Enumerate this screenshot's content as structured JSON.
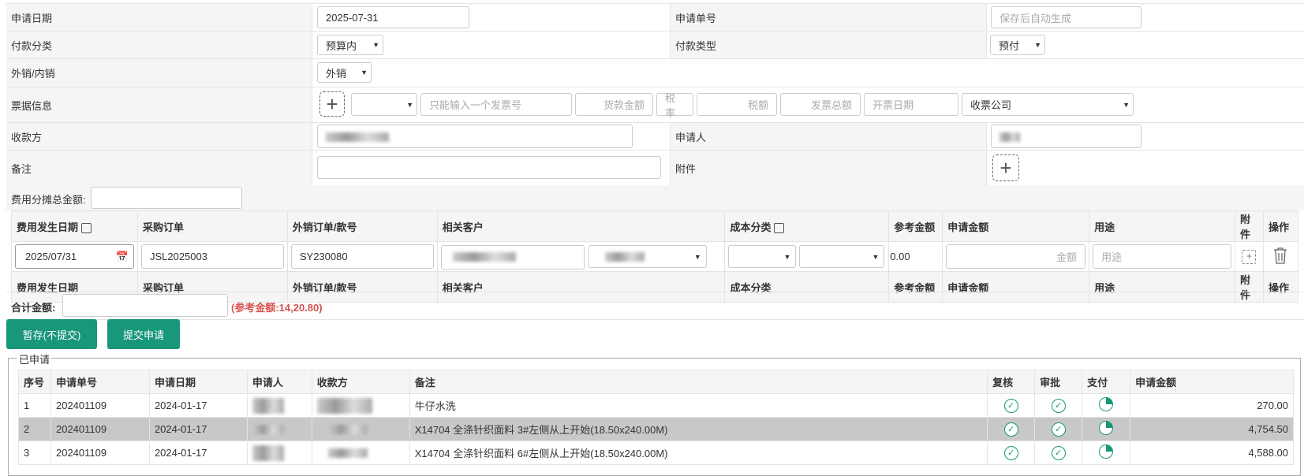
{
  "form": {
    "apply_date_label": "申请日期",
    "apply_date_value": "2025-07-31",
    "apply_no_label": "申请单号",
    "apply_no_placeholder": "保存后自动生成",
    "pay_category_label": "付款分类",
    "pay_category_value": "预算内",
    "pay_type_label": "付款类型",
    "pay_type_value": "预付",
    "sales_label": "外销/内销",
    "sales_value": "外销",
    "invoice_label": "票据信息",
    "invoice_no_placeholder": "只能输入一个发票号",
    "goods_amount_placeholder": "货款金额",
    "tax_rate_placeholder": "税率",
    "tax_placeholder": "税额",
    "invoice_total_placeholder": "发票总额",
    "invoice_date_placeholder": "开票日期",
    "receiver_company_value": "收票公司",
    "payee_label": "收款方",
    "applicant_label": "申请人",
    "remark_label": "备注",
    "attachment_label": "附件"
  },
  "allocation": {
    "total_label": "费用分摊总金额:",
    "headers": [
      "费用发生日期",
      "采购订单",
      "外销订单/款号",
      "相关客户",
      "成本分类",
      "参考金额",
      "申请金额",
      "用途",
      "附件",
      "操作"
    ],
    "row": {
      "date": "2025/07/31",
      "purchase_order": "JSL2025003",
      "sales_order": "SY230080",
      "ref_amount": "0.00",
      "amount_placeholder": "金额",
      "usage_placeholder": "用途"
    },
    "sum_label": "合计金额:",
    "ref_note": "(参考金额:14,20.80)"
  },
  "buttons": {
    "draft": "暂存(不提交)",
    "submit": "提交申请"
  },
  "applied": {
    "legend": "已申请",
    "headers": [
      "序号",
      "申请单号",
      "申请日期",
      "申请人",
      "收款方",
      "备注",
      "复核",
      "审批",
      "支付",
      "申请金额"
    ],
    "rows": [
      {
        "no": "1",
        "id": "202401109",
        "date": "2024-01-17",
        "remark": "牛仔水洗",
        "amount": "270.00"
      },
      {
        "no": "2",
        "id": "202401109",
        "date": "2024-01-17",
        "remark": "X14704 全涤针织面料 3#左侧从上开始(18.50x240.00M)",
        "amount": "4,754.50"
      },
      {
        "no": "3",
        "id": "202401109",
        "date": "2024-01-17",
        "remark": "X14704 全涤针织面料 6#左侧从上开始(18.50x240.00M)",
        "amount": "4,588.00"
      }
    ]
  },
  "colors": {
    "accent": "#18977a",
    "note": "#d9534f"
  }
}
